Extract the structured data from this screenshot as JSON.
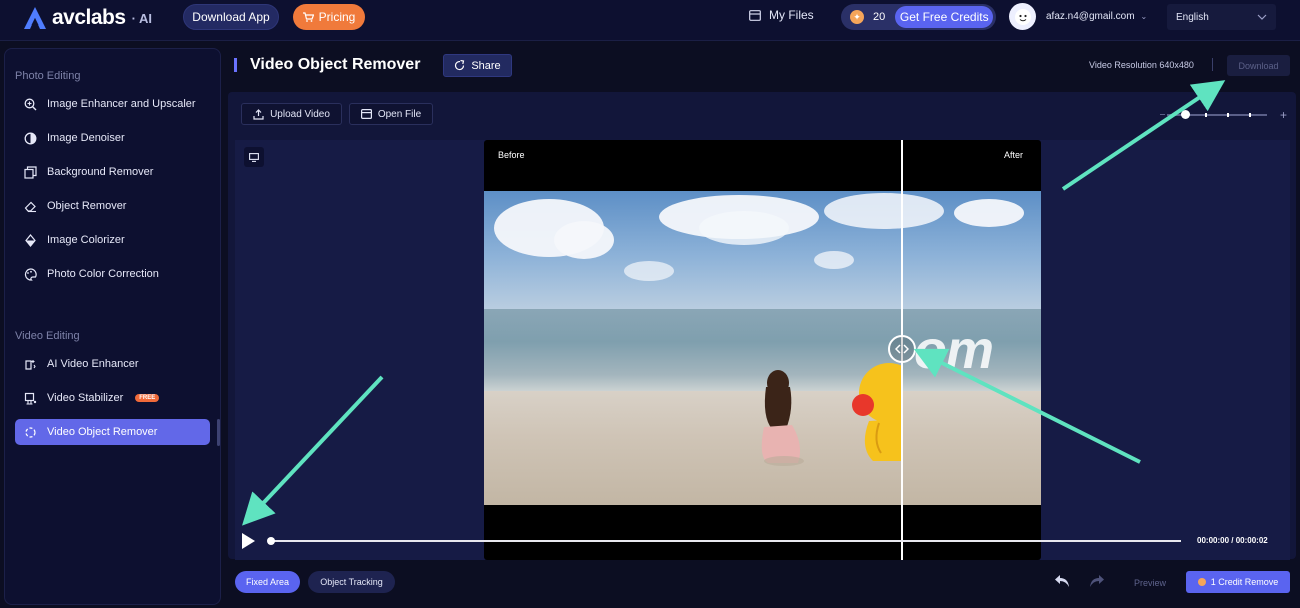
{
  "brand": {
    "logo_text": "avclabs",
    "logo_suffix": "· AI"
  },
  "topbar": {
    "download_app_label": "Download App",
    "pricing_label": "Pricing",
    "my_files_label": "My Files",
    "credits_count": "20",
    "free_credits_label": "Get Free Credits",
    "email": "afaz.n4@gmail.com",
    "language": "English"
  },
  "sidebar": {
    "photo_section_title": "Photo Editing",
    "photo_items": [
      {
        "label": "Image Enhancer and Upscaler",
        "icon": "zoom-icon"
      },
      {
        "label": "Image Denoiser",
        "icon": "denoise-icon"
      },
      {
        "label": "Background Remover",
        "icon": "layers-icon"
      },
      {
        "label": "Object Remover",
        "icon": "eraser-icon"
      },
      {
        "label": "Image Colorizer",
        "icon": "colorize-icon"
      },
      {
        "label": "Photo Color Correction",
        "icon": "palette-icon"
      }
    ],
    "video_section_title": "Video Editing",
    "video_items": [
      {
        "label": "AI Video Enhancer",
        "icon": "video-enhance-icon"
      },
      {
        "label": "Video Stabilizer",
        "icon": "stabilizer-icon",
        "badge": "FREE"
      },
      {
        "label": "Video Object Remover",
        "icon": "spinner-icon",
        "active": true
      }
    ]
  },
  "header": {
    "title": "Video Object Remover",
    "share_label": "Share",
    "resolution": "Video Resolution 640x480",
    "download_label": "Download"
  },
  "toolbar": {
    "upload_label": "Upload Video",
    "open_label": "Open File"
  },
  "preview": {
    "before_label": "Before",
    "after_label": "After",
    "watermark_text": "om",
    "divider_position_fraction": 0.75
  },
  "player": {
    "time": "00:00:00 / 00:00:02",
    "progress_fraction": 0.0
  },
  "bottom": {
    "fixed_area_label": "Fixed Area",
    "object_tracking_label": "Object Tracking",
    "preview_label": "Preview",
    "remove_label": "1 Credit Remove"
  },
  "colors": {
    "accent": "#5a64f0",
    "pricing": "#f07a3b",
    "background": "#0c0e22",
    "annotation_arrow": "#5fe3c0"
  }
}
